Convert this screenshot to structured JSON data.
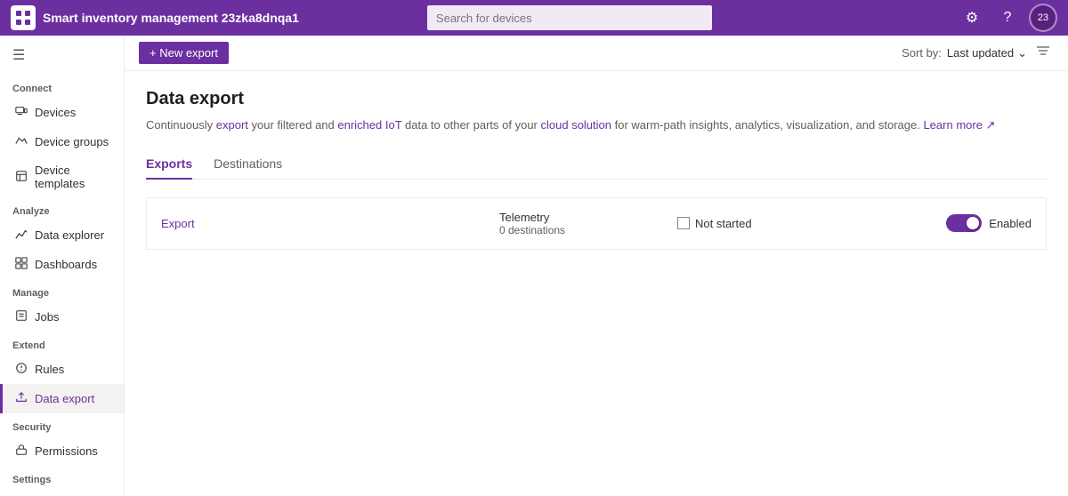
{
  "header": {
    "app_name": "Smart inventory management 23zka8dnqa1",
    "search_placeholder": "Search for devices",
    "settings_icon": "⚙",
    "help_icon": "?",
    "avatar_label": "23"
  },
  "sidebar": {
    "hamburger_icon": "☰",
    "sections": [
      {
        "label": "Connect",
        "items": [
          {
            "id": "devices",
            "label": "Devices",
            "icon": "💻",
            "active": false
          },
          {
            "id": "device-groups",
            "label": "Device groups",
            "icon": "📊",
            "active": false
          },
          {
            "id": "device-templates",
            "label": "Device templates",
            "icon": "📋",
            "active": false
          }
        ]
      },
      {
        "label": "Analyze",
        "items": [
          {
            "id": "data-explorer",
            "label": "Data explorer",
            "icon": "📈",
            "active": false
          },
          {
            "id": "dashboards",
            "label": "Dashboards",
            "icon": "⊞",
            "active": false
          }
        ]
      },
      {
        "label": "Manage",
        "items": [
          {
            "id": "jobs",
            "label": "Jobs",
            "icon": "📄",
            "active": false
          }
        ]
      },
      {
        "label": "Extend",
        "items": [
          {
            "id": "rules",
            "label": "Rules",
            "icon": "⚙",
            "active": false
          },
          {
            "id": "data-export",
            "label": "Data export",
            "icon": "↗",
            "active": true
          }
        ]
      },
      {
        "label": "Security",
        "items": [
          {
            "id": "permissions",
            "label": "Permissions",
            "icon": "🔑",
            "active": false
          }
        ]
      },
      {
        "label": "Settings",
        "items": []
      }
    ]
  },
  "toolbar": {
    "new_export_label": "+ New export",
    "sort_by_label": "Sort by:",
    "sort_value": "Last updated",
    "chevron_icon": "⌄",
    "filter_icon": "⊟"
  },
  "page": {
    "title": "Data export",
    "description_parts": [
      {
        "text": "Continuously ",
        "highlight": false
      },
      {
        "text": "export",
        "highlight": true
      },
      {
        "text": " your filtered and ",
        "highlight": false
      },
      {
        "text": "enriched IoT",
        "highlight": true
      },
      {
        "text": " data to other parts of your ",
        "highlight": false
      },
      {
        "text": "cloud solution",
        "highlight": true
      },
      {
        "text": " for warm-path insights, analytics, visualization, and storage. ",
        "highlight": false
      },
      {
        "text": "Learn more ↗",
        "highlight": true,
        "link": true
      }
    ],
    "tabs": [
      {
        "id": "exports",
        "label": "Exports",
        "active": true
      },
      {
        "id": "destinations",
        "label": "Destinations",
        "active": false
      }
    ],
    "exports": [
      {
        "name": "Export",
        "type": "Telemetry",
        "destinations": "0 destinations",
        "status": "Not started",
        "enabled": true,
        "enabled_label": "Enabled"
      }
    ]
  }
}
